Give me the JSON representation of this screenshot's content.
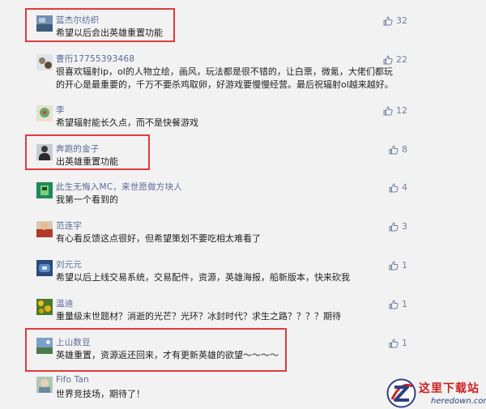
{
  "comments": [
    {
      "name": "蓝杰尔纺织",
      "text": "希望以后会出英雄重置功能",
      "likes": "32",
      "highlighted": true
    },
    {
      "name": "曹衎17755393468",
      "text": "很喜欢辐射ip，ol的人物立绘，画风，玩法都是很不错的，让白票，微氪，大佬们都玩",
      "text2": "的开心是最重要的，千万不要杀鸡取卵，好游戏要慢慢经营。最后祝辐射ol越来越好。",
      "likes": "22",
      "highlighted": false
    },
    {
      "name": "李",
      "text": "希望辐射能长久点，而不是快餐游戏",
      "likes": "12",
      "highlighted": false
    },
    {
      "name": "奔跑的金子",
      "text": "出英雄重置功能",
      "likes": "8",
      "highlighted": true
    },
    {
      "name": "此生无悔入MC，来世愿做方块人",
      "text": "我第一个看到的",
      "likes": "4",
      "highlighted": false
    },
    {
      "name": "范连宇",
      "text": "有心看反馈这点很好，但希望策划不要吃相太难看了",
      "likes": "3",
      "highlighted": false
    },
    {
      "name": "刘元元",
      "text": "希望以后上线交易系统，交易配件，资源，英雄海报，船新版本，快来砍我",
      "likes": "1",
      "highlighted": false
    },
    {
      "name": "温迪",
      "text": "重量级末世题材？消逝的光芒？光环？冰封时代？求生之路？？？？期待",
      "likes": "1",
      "highlighted": false
    },
    {
      "name": "上山数豆",
      "text": "英雄重置，资源返还回来，才有更新英雄的欲望～～～～",
      "likes": "1",
      "highlighted": true
    },
    {
      "name": "Fifo Tan",
      "text": "世界竞技场，期待了！",
      "likes": "",
      "highlighted": false
    }
  ],
  "watermark": {
    "title": "这里下载站",
    "domain": "heredown.com"
  },
  "colors": {
    "name": "#5a6a9a",
    "text": "#1e1e1e",
    "like": "#6f7fa0",
    "highlight": "#e03b3b",
    "background": "#f2f2f2"
  }
}
